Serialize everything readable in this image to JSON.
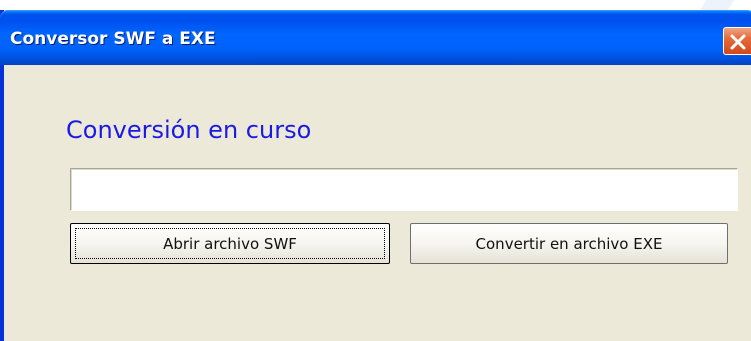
{
  "window": {
    "title": "Conversor SWF a EXE",
    "close_icon": "close-icon"
  },
  "main": {
    "heading": "Conversión en curso",
    "progress": 0
  },
  "buttons": {
    "open_label": "Abrir archivo SWF",
    "convert_label": "Convertir en archivo EXE"
  },
  "colors": {
    "titlebar": "#0055e5",
    "close_button": "#e46a3c",
    "heading": "#1a1ae6",
    "dialog_background": "#ece9d8"
  }
}
